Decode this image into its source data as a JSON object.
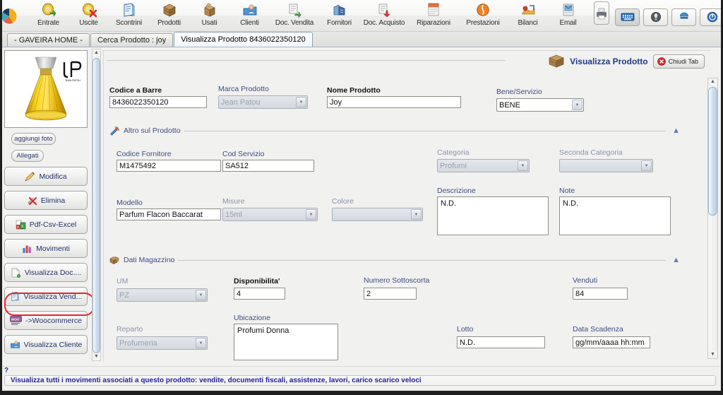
{
  "toolbar": {
    "logo_name": "app-logo-pie",
    "items": [
      {
        "label": "Entrate",
        "icon": "coin-in-icon"
      },
      {
        "label": "Uscite",
        "icon": "coin-out-icon"
      },
      {
        "label": "Scontrini",
        "icon": "receipt-icon"
      },
      {
        "label": "Prodotti",
        "icon": "box-stack-icon"
      },
      {
        "label": "Usati",
        "icon": "open-box-icon"
      },
      {
        "label": "Clienti",
        "icon": "customer-icon"
      },
      {
        "label": "Doc. Vendita",
        "icon": "sales-doc-icon"
      },
      {
        "label": "Fornitori",
        "icon": "supplier-icon"
      },
      {
        "label": "Doc. Acquisto",
        "icon": "purchase-doc-icon"
      },
      {
        "label": "Riparazioni",
        "icon": "repair-icon"
      },
      {
        "label": "Prestazioni",
        "icon": "service-icon"
      },
      {
        "label": "Bilanci",
        "icon": "balance-icon"
      },
      {
        "label": "Email",
        "icon": "email-icon"
      }
    ],
    "print_button_icon": "printer-icon",
    "right_buttons": [
      {
        "icon": "keyboard-icon",
        "state": "active"
      },
      {
        "icon": "info-icon",
        "state": "normal"
      },
      {
        "icon": "minimize-icon",
        "state": "normal"
      },
      {
        "icon": "power-icon",
        "state": "normal"
      }
    ]
  },
  "tabs": [
    {
      "label": "- GAVEIRA HOME -",
      "active": false
    },
    {
      "label": "Cerca Prodotto : joy",
      "active": false
    },
    {
      "label": "Visualizza Prodotto 8436022350120",
      "active": true
    }
  ],
  "sidebar": {
    "photo_alt": "product-photo-joy-jean-patou",
    "small_buttons": [
      {
        "label": "aggiungi foto",
        "name": "add-photo-button"
      },
      {
        "label": "Allegati",
        "name": "attachments-button"
      }
    ],
    "buttons": [
      {
        "label": "Modifica",
        "icon": "pencil-icon",
        "name": "edit-button",
        "highlighted": false
      },
      {
        "label": "Elimina",
        "icon": "delete-x-icon",
        "name": "delete-button",
        "highlighted": false
      },
      {
        "label": "Pdf-Csv-Excel",
        "icon": "export-icon",
        "name": "export-button",
        "highlighted": false
      },
      {
        "label": "Movimenti",
        "icon": "bar-chart-icon",
        "name": "movements-button",
        "highlighted": true
      },
      {
        "label": "Visualizza Doc....",
        "icon": "document-icon",
        "name": "view-documents-button",
        "highlighted": false
      },
      {
        "label": "Visualizza Vend...",
        "icon": "receipt-icon",
        "name": "view-sales-button",
        "highlighted": false
      },
      {
        "label": "->Woocommerce",
        "icon": "woocommerce-icon",
        "name": "woocommerce-button",
        "highlighted": false
      },
      {
        "label": "Visualizza Cliente",
        "icon": "customer-icon",
        "name": "view-customer-button",
        "highlighted": false
      }
    ]
  },
  "panel": {
    "title": "Visualizza Prodotto",
    "title_icon": "box-stack-icon",
    "close_tab_label": "Chiudi Tab",
    "close_tab_icon": "close-red-icon"
  },
  "form": {
    "codice_a_barre": {
      "label": "Codice a Barre",
      "value": "8436022350120"
    },
    "marca_prodotto": {
      "label": "Marca Prodotto",
      "value": "Jean Patou"
    },
    "nome_prodotto": {
      "label": "Nome Prodotto",
      "value": "Joy"
    },
    "bene_servizio": {
      "label": "Bene/Servizio",
      "value": "BENE"
    }
  },
  "section_altro": {
    "title": "Altro sul Prodotto",
    "icon": "tools-icon",
    "collapse_icon": "chevron-up-icon",
    "codice_fornitore": {
      "label": "Codice Fornitore",
      "value": "M1475492"
    },
    "cod_servizio": {
      "label": "Cod Servizio",
      "value": "SA512"
    },
    "categoria": {
      "label": "Categoria",
      "value": "Profumi"
    },
    "seconda_categoria": {
      "label": "Seconda Categoria",
      "value": ""
    },
    "modello": {
      "label": "Modello",
      "value": "Parfum Flacon Baccarat"
    },
    "misure": {
      "label": "Misure",
      "value": "15ml"
    },
    "colore": {
      "label": "Colore",
      "value": ""
    },
    "descrizione": {
      "label": "Descrizione",
      "value": "N.D."
    },
    "note": {
      "label": "Note",
      "value": "N.D."
    }
  },
  "section_magazzino": {
    "title": "Dati Magazzino",
    "icon": "warehouse-box-icon",
    "collapse_icon": "chevron-up-icon",
    "um": {
      "label": "UM",
      "value": "PZ"
    },
    "disponibilita": {
      "label": "Disponibilita'",
      "value": "4"
    },
    "numero_sottoscorta": {
      "label": "Numero Sottoscorta",
      "value": "2"
    },
    "venduti": {
      "label": "Venduti",
      "value": "84"
    },
    "reparto": {
      "label": "Reparto",
      "value": "Profumeria"
    },
    "ubicazione": {
      "label": "Ubicazione",
      "value": "Profumi Donna"
    },
    "lotto": {
      "label": "Lotto",
      "value": "N.D."
    },
    "data_scadenza": {
      "label": "Data Scadenza",
      "value": "gg/mm/aaaa hh:mm"
    }
  },
  "status": {
    "help_marker": "?",
    "message": "Visualizza tutti i movimenti associati a questo prodotto: vendite, documenti fiscali, assistenze, lavori, carico scarico veloci"
  },
  "colors": {
    "label_blue": "#3d4c84",
    "title_blue": "#1c3a8c",
    "highlight_red": "#e8252a",
    "status_blue": "#21219a"
  }
}
